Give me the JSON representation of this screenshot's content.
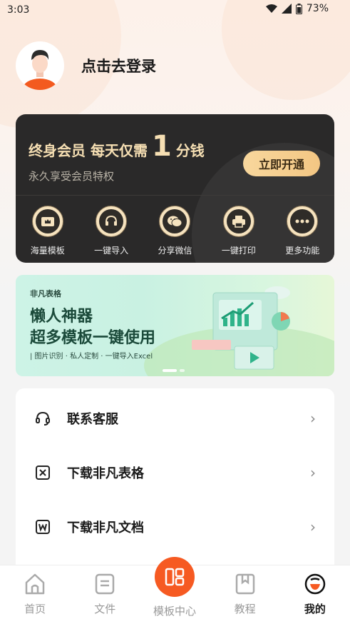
{
  "status_bar": {
    "time": "3:03",
    "battery": "73%"
  },
  "profile": {
    "login_text": "点击去登录"
  },
  "vip": {
    "title_prefix": "终身会员 每天仅需",
    "title_number": "1",
    "title_suffix": "分钱",
    "subtitle": "永久享受会员特权",
    "button_label": "立即开通",
    "features": [
      {
        "label": "海量模板",
        "icon": "crown-template-icon"
      },
      {
        "label": "一键导入",
        "icon": "headset-icon"
      },
      {
        "label": "分享微信",
        "icon": "wechat-icon"
      },
      {
        "label": "一键打印",
        "icon": "printer-icon"
      },
      {
        "label": "更多功能",
        "icon": "more-dots-icon"
      }
    ]
  },
  "banner": {
    "brand": "非凡表格",
    "headline1": "懒人神器",
    "headline2": "超多模板一键使用",
    "tagline": "| 图片识别 · 私人定制 · 一键导入Excel"
  },
  "menu": {
    "items": [
      {
        "label": "联系客服",
        "icon": "headset-outline-icon"
      },
      {
        "label": "下载非凡表格",
        "icon": "x-box-icon"
      },
      {
        "label": "下载非凡文档",
        "icon": "w-box-icon"
      }
    ]
  },
  "tabs": [
    {
      "label": "首页",
      "icon": "home-icon"
    },
    {
      "label": "文件",
      "icon": "file-icon"
    },
    {
      "label": "模板中心",
      "icon": "template-center-icon"
    },
    {
      "label": "教程",
      "icon": "tutorial-icon"
    },
    {
      "label": "我的",
      "icon": "profile-icon"
    }
  ],
  "colors": {
    "accent": "#f65a22",
    "vip_gold": "#f3c683",
    "vip_dark": "#2a2929"
  }
}
